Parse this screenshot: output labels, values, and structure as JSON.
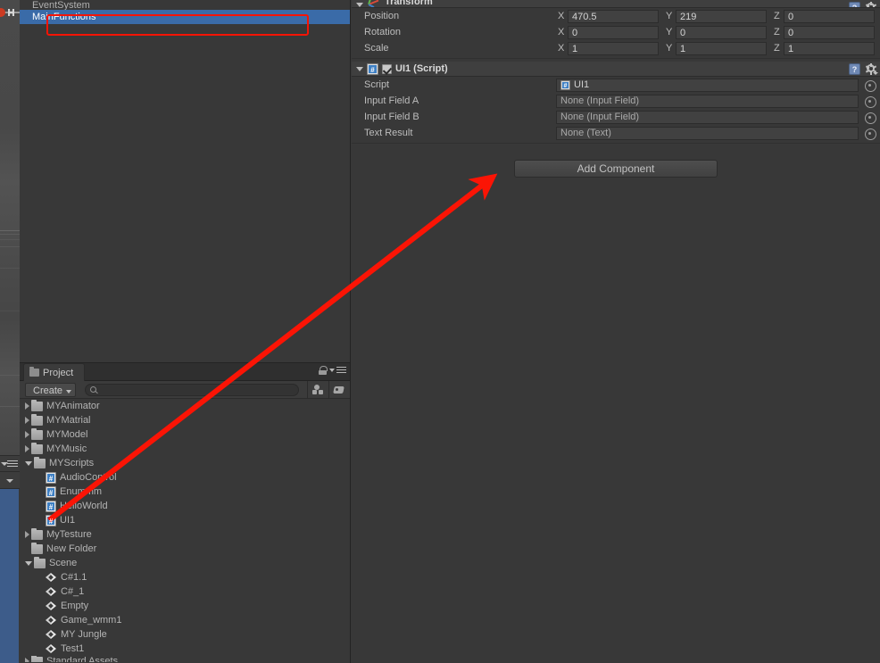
{
  "hierarchy": {
    "rows": [
      {
        "label": "EventSystem",
        "selected": false,
        "clipped": true
      },
      {
        "label": "MainFunctions",
        "selected": true,
        "clipped": false
      }
    ],
    "highlight_color": "#f51405",
    "selection_color": "#3a6ba8"
  },
  "inspector": {
    "transform": {
      "title": "Transform",
      "icon": "transform-axis-icon",
      "rows": [
        {
          "label": "Position",
          "x": "470.5",
          "y": "219",
          "z": "0"
        },
        {
          "label": "Rotation",
          "x": "0",
          "y": "0",
          "z": "0"
        },
        {
          "label": "Scale",
          "x": "1",
          "y": "1",
          "z": "1"
        }
      ],
      "axis_labels": {
        "x": "X",
        "y": "Y",
        "z": "Z"
      }
    },
    "script_component": {
      "title": "UI1 (Script)",
      "enabled": true,
      "help_label": "?",
      "rows": [
        {
          "label": "Script",
          "value": "UI1",
          "has_value": true
        },
        {
          "label": "Input Field A",
          "value": "None (Input Field)",
          "has_value": false
        },
        {
          "label": "Input Field B",
          "value": "None (Input Field)",
          "has_value": false
        },
        {
          "label": "Text Result",
          "value": "None (Text)",
          "has_value": false
        }
      ]
    },
    "add_component_label": "Add Component"
  },
  "project": {
    "tab_label": "Project",
    "create_label": "Create",
    "search_placeholder": "",
    "tree": [
      {
        "label": "MYAnimator",
        "indent": 0,
        "twisty": "right",
        "icon": "folder"
      },
      {
        "label": "MYMatrial",
        "indent": 0,
        "twisty": "right",
        "icon": "folder"
      },
      {
        "label": "MYModel",
        "indent": 0,
        "twisty": "right",
        "icon": "folder"
      },
      {
        "label": "MYMusic",
        "indent": 0,
        "twisty": "right",
        "icon": "folder"
      },
      {
        "label": "MYScripts",
        "indent": 0,
        "twisty": "down",
        "icon": "folder"
      },
      {
        "label": "AudioControl",
        "indent": 1,
        "twisty": "none",
        "icon": "csharp"
      },
      {
        "label": "Enummm",
        "indent": 1,
        "twisty": "none",
        "icon": "csharp"
      },
      {
        "label": "HelloWorld",
        "indent": 1,
        "twisty": "none",
        "icon": "csharp"
      },
      {
        "label": "UI1",
        "indent": 1,
        "twisty": "none",
        "icon": "csharp"
      },
      {
        "label": "MyTesture",
        "indent": 0,
        "twisty": "right",
        "icon": "folder"
      },
      {
        "label": "New Folder",
        "indent": 0,
        "twisty": "none",
        "icon": "folder"
      },
      {
        "label": "Scene",
        "indent": 0,
        "twisty": "down",
        "icon": "folder"
      },
      {
        "label": "C#1.1",
        "indent": 1,
        "twisty": "none",
        "icon": "unity"
      },
      {
        "label": "C#_1",
        "indent": 1,
        "twisty": "none",
        "icon": "unity"
      },
      {
        "label": "Empty",
        "indent": 1,
        "twisty": "none",
        "icon": "unity"
      },
      {
        "label": "Game_wmm1",
        "indent": 1,
        "twisty": "none",
        "icon": "unity"
      },
      {
        "label": "MY Jungle",
        "indent": 1,
        "twisty": "none",
        "icon": "unity"
      },
      {
        "label": "Test1",
        "indent": 1,
        "twisty": "none",
        "icon": "unity"
      },
      {
        "label": "Standard Assets",
        "indent": 0,
        "twisty": "right",
        "icon": "folder",
        "clipped": true
      }
    ]
  },
  "annotation": {
    "arrow_color": "#fb1405",
    "arrow_from": "55,583",
    "arrow_to": "548,201"
  }
}
